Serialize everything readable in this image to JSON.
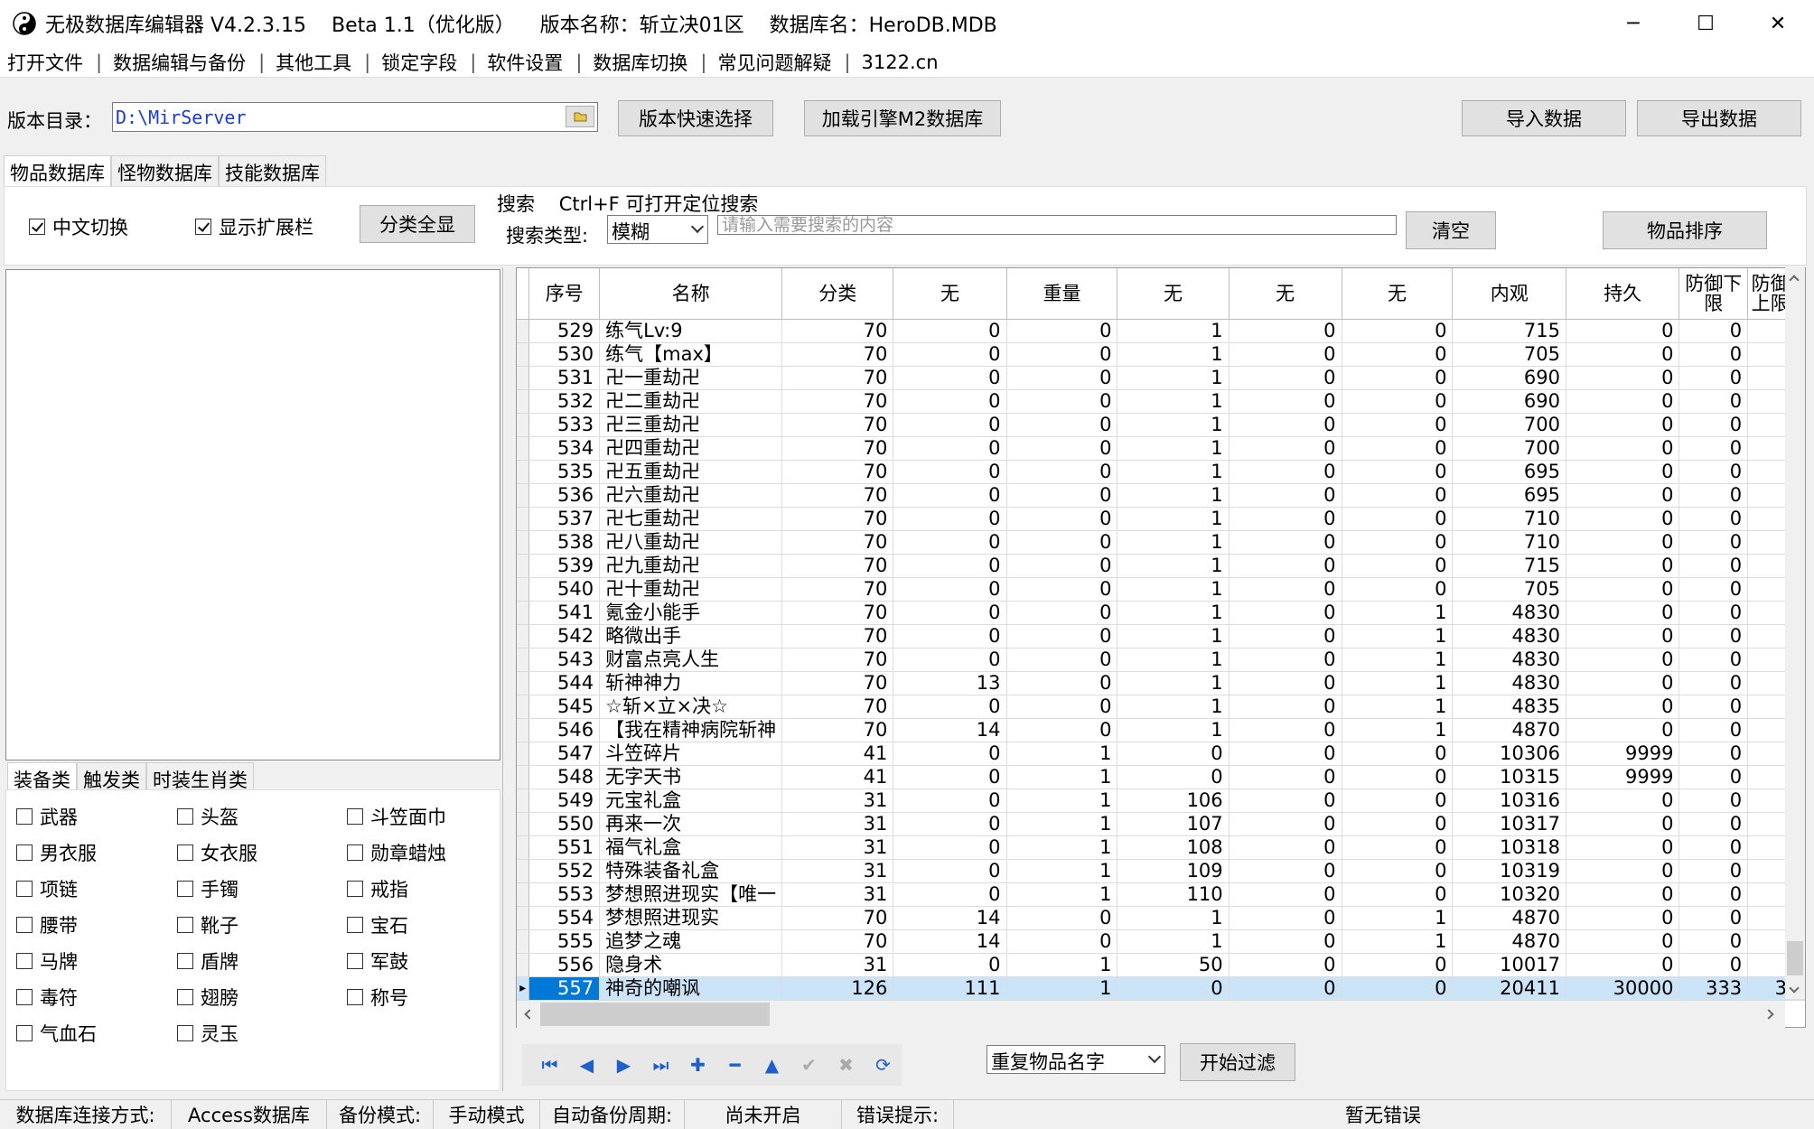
{
  "window": {
    "title": "无极数据库编辑器 V4.2.3.15    Beta 1.1（优化版）    版本名称：斩立决01区    数据库名：HeroDB.MDB",
    "minimize": "─",
    "maximize": "☐",
    "close": "✕"
  },
  "menu": [
    "打开文件",
    "数据编辑与备份",
    "其他工具",
    "锁定字段",
    "软件设置",
    "数据库切换",
    "常见问题解疑",
    "3122.cn"
  ],
  "toolbar": {
    "dir_label": "版本目录：",
    "dir_value": "D:\\MirServer",
    "quick_select": "版本快速选择",
    "load_m2": "加载引擎M2数据库",
    "import": "导入数据",
    "export": "导出数据"
  },
  "db_tabs": [
    "物品数据库",
    "怪物数据库",
    "技能数据库"
  ],
  "options": {
    "cn_switch": "中文切换",
    "show_ext": "显示扩展栏",
    "show_all": "分类全显",
    "search_title": "搜索    Ctrl+F 可打开定位搜索",
    "search_type_label": "搜索类型:",
    "search_type_value": "模糊",
    "search_placeholder": "请输入需要搜索的内容",
    "clear": "清空",
    "sort": "物品排序"
  },
  "category_tabs": [
    "装备类",
    "触发类",
    "时装生肖类"
  ],
  "categories": [
    [
      "武器",
      "头盔",
      "斗笠面巾"
    ],
    [
      "男衣服",
      "女衣服",
      "勋章蜡烛"
    ],
    [
      "项链",
      "手镯",
      "戒指"
    ],
    [
      "腰带",
      "靴子",
      "宝石"
    ],
    [
      "马牌",
      "盾牌",
      "军鼓"
    ],
    [
      "毒符",
      "翅膀",
      "称号"
    ],
    [
      "气血石",
      "灵玉"
    ]
  ],
  "table": {
    "columns": [
      "序号",
      "名称",
      "分类",
      "无",
      "重量",
      "无",
      "无",
      "无",
      "内观",
      "持久",
      "防御下限",
      "防御上限"
    ],
    "rows": [
      [
        "529",
        "练气Lv:9",
        "70",
        "0",
        "0",
        "1",
        "0",
        "0",
        "715",
        "0",
        "0",
        ""
      ],
      [
        "530",
        "练气【max】",
        "70",
        "0",
        "0",
        "1",
        "0",
        "0",
        "705",
        "0",
        "0",
        ""
      ],
      [
        "531",
        "卍一重劫卍",
        "70",
        "0",
        "0",
        "1",
        "0",
        "0",
        "690",
        "0",
        "0",
        ""
      ],
      [
        "532",
        "卍二重劫卍",
        "70",
        "0",
        "0",
        "1",
        "0",
        "0",
        "690",
        "0",
        "0",
        ""
      ],
      [
        "533",
        "卍三重劫卍",
        "70",
        "0",
        "0",
        "1",
        "0",
        "0",
        "700",
        "0",
        "0",
        ""
      ],
      [
        "534",
        "卍四重劫卍",
        "70",
        "0",
        "0",
        "1",
        "0",
        "0",
        "700",
        "0",
        "0",
        ""
      ],
      [
        "535",
        "卍五重劫卍",
        "70",
        "0",
        "0",
        "1",
        "0",
        "0",
        "695",
        "0",
        "0",
        ""
      ],
      [
        "536",
        "卍六重劫卍",
        "70",
        "0",
        "0",
        "1",
        "0",
        "0",
        "695",
        "0",
        "0",
        ""
      ],
      [
        "537",
        "卍七重劫卍",
        "70",
        "0",
        "0",
        "1",
        "0",
        "0",
        "710",
        "0",
        "0",
        ""
      ],
      [
        "538",
        "卍八重劫卍",
        "70",
        "0",
        "0",
        "1",
        "0",
        "0",
        "710",
        "0",
        "0",
        ""
      ],
      [
        "539",
        "卍九重劫卍",
        "70",
        "0",
        "0",
        "1",
        "0",
        "0",
        "715",
        "0",
        "0",
        ""
      ],
      [
        "540",
        "卍十重劫卍",
        "70",
        "0",
        "0",
        "1",
        "0",
        "0",
        "705",
        "0",
        "0",
        ""
      ],
      [
        "541",
        "氪金小能手",
        "70",
        "0",
        "0",
        "1",
        "0",
        "1",
        "4830",
        "0",
        "0",
        ""
      ],
      [
        "542",
        "略微出手",
        "70",
        "0",
        "0",
        "1",
        "0",
        "1",
        "4830",
        "0",
        "0",
        ""
      ],
      [
        "543",
        "财富点亮人生",
        "70",
        "0",
        "0",
        "1",
        "0",
        "1",
        "4830",
        "0",
        "0",
        ""
      ],
      [
        "544",
        "斩神神力",
        "70",
        "13",
        "0",
        "1",
        "0",
        "1",
        "4830",
        "0",
        "0",
        ""
      ],
      [
        "545",
        "☆斩×立×决☆",
        "70",
        "0",
        "0",
        "1",
        "0",
        "1",
        "4835",
        "0",
        "0",
        ""
      ],
      [
        "546",
        "【我在精神病院斩神",
        "70",
        "14",
        "0",
        "1",
        "0",
        "1",
        "4870",
        "0",
        "0",
        ""
      ],
      [
        "547",
        "斗笠碎片",
        "41",
        "0",
        "1",
        "0",
        "0",
        "0",
        "10306",
        "9999",
        "0",
        ""
      ],
      [
        "548",
        "无字天书",
        "41",
        "0",
        "1",
        "0",
        "0",
        "0",
        "10315",
        "9999",
        "0",
        ""
      ],
      [
        "549",
        "元宝礼盒",
        "31",
        "0",
        "1",
        "106",
        "0",
        "0",
        "10316",
        "0",
        "0",
        ""
      ],
      [
        "550",
        "再来一次",
        "31",
        "0",
        "1",
        "107",
        "0",
        "0",
        "10317",
        "0",
        "0",
        ""
      ],
      [
        "551",
        "福气礼盒",
        "31",
        "0",
        "1",
        "108",
        "0",
        "0",
        "10318",
        "0",
        "0",
        ""
      ],
      [
        "552",
        "特殊装备礼盒",
        "31",
        "0",
        "1",
        "109",
        "0",
        "0",
        "10319",
        "0",
        "0",
        ""
      ],
      [
        "553",
        "梦想照进现实【唯一",
        "31",
        "0",
        "1",
        "110",
        "0",
        "0",
        "10320",
        "0",
        "0",
        ""
      ],
      [
        "554",
        "梦想照进现实",
        "70",
        "14",
        "0",
        "1",
        "0",
        "1",
        "4870",
        "0",
        "0",
        ""
      ],
      [
        "555",
        "追梦之魂",
        "70",
        "14",
        "0",
        "1",
        "0",
        "1",
        "4870",
        "0",
        "0",
        ""
      ],
      [
        "556",
        "隐身术",
        "31",
        "0",
        "1",
        "50",
        "0",
        "0",
        "10017",
        "0",
        "0",
        ""
      ],
      [
        "557",
        "神奇的嘲讽",
        "126",
        "111",
        "1",
        "0",
        "0",
        "0",
        "20411",
        "30000",
        "333",
        "3"
      ]
    ],
    "selected_row": "557"
  },
  "navigator": [
    "first",
    "prior",
    "next",
    "last",
    "insert",
    "delete",
    "edit",
    "post",
    "cancel",
    "refresh"
  ],
  "filter": {
    "type_value": "重复物品名字",
    "start": "开始过滤"
  },
  "status": {
    "conn_label": "数据库连接方式:",
    "conn_value": "Access数据库",
    "backup_label": "备份模式:",
    "backup_value": "手动模式",
    "auto_label": "自动备份周期:",
    "auto_value": "尚未开启",
    "err_label": "错误提示:",
    "err_value": "暂无错误"
  },
  "colors": {
    "selection": "#0078d7",
    "path_text": "#1a3cd6",
    "nav_icon": "#1f5fcc"
  }
}
